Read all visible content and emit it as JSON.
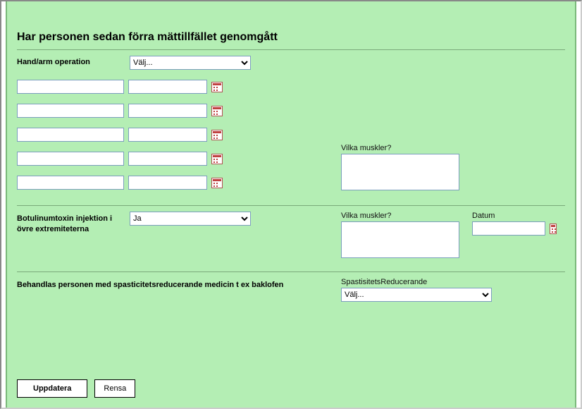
{
  "heading": "Har personen sedan förra mättillfället genomgått",
  "handArm": {
    "label": "Hand/arm operation",
    "selectPlaceholder": "Välj...",
    "rows": [
      {
        "a": "",
        "b": ""
      },
      {
        "a": "",
        "b": ""
      },
      {
        "a": "",
        "b": ""
      },
      {
        "a": "",
        "b": ""
      },
      {
        "a": "",
        "b": ""
      }
    ],
    "musclesLabel": "Vilka muskler?",
    "musclesValue": ""
  },
  "botox": {
    "label": "Botulinumtoxin injektion i övre extremiteterna",
    "selectValue": "Ja",
    "musclesLabel": "Vilka muskler?",
    "musclesValue": "",
    "dateLabel": "Datum",
    "dateValue": ""
  },
  "spast": {
    "label": "Behandlas personen med spasticitetsreducerande medicin t ex baklofen",
    "selectLabel": "SpastisitetsReducerande",
    "selectPlaceholder": "Välj..."
  },
  "buttons": {
    "update": "Uppdatera",
    "clear": "Rensa"
  }
}
